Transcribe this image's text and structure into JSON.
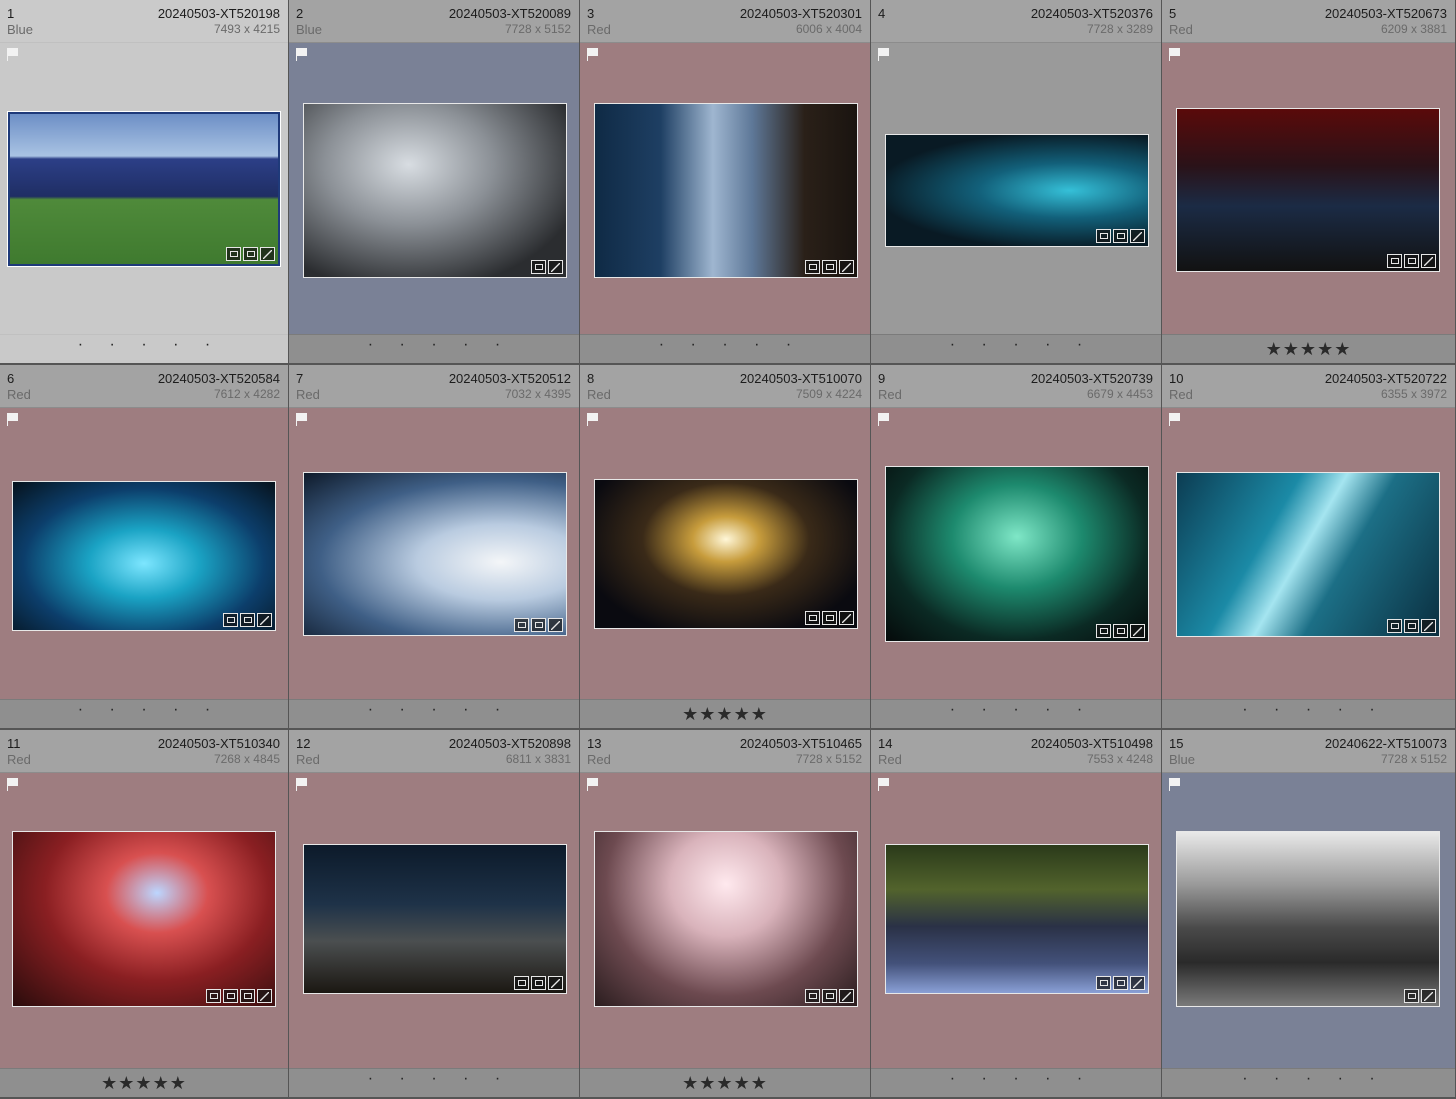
{
  "cells": [
    {
      "index": "1",
      "filename": "20240503-XT520198",
      "label": "Blue",
      "dims": "7493 x 4215",
      "rating": "· · · · ·",
      "tint": "sel",
      "photo": "tivoli-stage-lawn",
      "badges": [
        "virtual-copy",
        "crop",
        "edit"
      ]
    },
    {
      "index": "2",
      "filename": "20240503-XT520089",
      "label": "Blue",
      "dims": "7728 x 5152",
      "rating": "· · · · ·",
      "tint": "blue",
      "photo": "bassist-silhouette",
      "badges": [
        "crop",
        "edit"
      ]
    },
    {
      "index": "3",
      "filename": "20240503-XT520301",
      "label": "Red",
      "dims": "6006 x 4004",
      "rating": "· · · · ·",
      "tint": "red",
      "photo": "band-hug-backstage",
      "badges": [
        "virtual-copy",
        "crop",
        "edit"
      ]
    },
    {
      "index": "4",
      "filename": "20240503-XT520376",
      "label": "",
      "dims": "7728 x 3289",
      "rating": "· · · · ·",
      "tint": "none",
      "photo": "stage-teal-lights",
      "badges": [
        "virtual-copy",
        "crop",
        "edit"
      ]
    },
    {
      "index": "5",
      "filename": "20240503-XT520673",
      "label": "Red",
      "dims": "6209 x 3881",
      "rating": "★★★★★",
      "tint": "red",
      "photo": "stage-red-lights",
      "badges": [
        "virtual-copy",
        "crop",
        "edit"
      ]
    },
    {
      "index": "6",
      "filename": "20240503-XT520584",
      "label": "Red",
      "dims": "7612 x 4282",
      "rating": "· · · · ·",
      "tint": "red",
      "photo": "tivoli-crowd-blue",
      "badges": [
        "virtual-copy",
        "crop",
        "edit"
      ]
    },
    {
      "index": "7",
      "filename": "20240503-XT520512",
      "label": "Red",
      "dims": "7032 x 4395",
      "rating": "· · · · ·",
      "tint": "red",
      "photo": "keyboardist-backlit",
      "badges": [
        "virtual-copy",
        "crop",
        "edit"
      ]
    },
    {
      "index": "8",
      "filename": "20240503-XT510070",
      "label": "Red",
      "dims": "7509 x 4224",
      "rating": "★★★★★",
      "tint": "red",
      "photo": "crowd-night-stage",
      "badges": [
        "virtual-copy",
        "crop",
        "edit"
      ]
    },
    {
      "index": "9",
      "filename": "20240503-XT520739",
      "label": "Red",
      "dims": "6679 x 4453",
      "rating": "· · · · ·",
      "tint": "red",
      "photo": "singer-green-lights",
      "badges": [
        "virtual-copy",
        "crop",
        "edit"
      ]
    },
    {
      "index": "10",
      "filename": "20240503-XT520722",
      "label": "Red",
      "dims": "6355 x 3972",
      "rating": "· · · · ·",
      "tint": "red",
      "photo": "guitarist-teal-beam",
      "badges": [
        "virtual-copy",
        "crop",
        "edit"
      ]
    },
    {
      "index": "11",
      "filename": "20240503-XT510340",
      "label": "Red",
      "dims": "7268 x 4845",
      "rating": "★★★★★",
      "tint": "red",
      "photo": "singer-red-haze",
      "badges": [
        "metadata",
        "virtual-copy",
        "crop",
        "edit"
      ]
    },
    {
      "index": "12",
      "filename": "20240503-XT520898",
      "label": "Red",
      "dims": "6811 x 3831",
      "rating": "· · · · ·",
      "tint": "red",
      "photo": "band-figaro-night",
      "badges": [
        "virtual-copy",
        "crop",
        "edit"
      ]
    },
    {
      "index": "13",
      "filename": "20240503-XT510465",
      "label": "Red",
      "dims": "7728 x 5152",
      "rating": "★★★★★",
      "tint": "red",
      "photo": "singer-mic-stand",
      "badges": [
        "metadata",
        "crop",
        "edit"
      ]
    },
    {
      "index": "14",
      "filename": "20240503-XT510498",
      "label": "Red",
      "dims": "7553 x 4248",
      "rating": "· · · · ·",
      "tint": "red",
      "photo": "band-bow-crowd",
      "badges": [
        "virtual-copy",
        "crop",
        "edit"
      ]
    },
    {
      "index": "15",
      "filename": "20240622-XT510073",
      "label": "Blue",
      "dims": "7728 x 5152",
      "rating": "· · · · ·",
      "tint": "blue",
      "photo": "band-bw-stadium",
      "badges": [
        "crop",
        "edit"
      ]
    }
  ]
}
